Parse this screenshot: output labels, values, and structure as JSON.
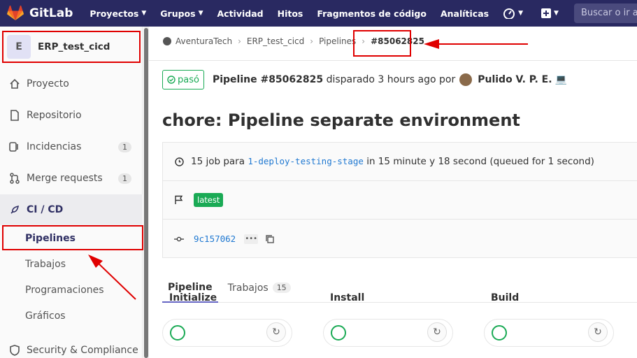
{
  "topbar": {
    "brand": "GitLab",
    "nav": [
      {
        "label": "Proyectos",
        "dropdown": true
      },
      {
        "label": "Grupos",
        "dropdown": true
      },
      {
        "label": "Actividad",
        "dropdown": false
      },
      {
        "label": "Hitos",
        "dropdown": false
      },
      {
        "label": "Fragmentos de código",
        "dropdown": false
      },
      {
        "label": "Analíticas",
        "dropdown": false
      }
    ],
    "search_placeholder": "Buscar o ir a"
  },
  "sidebar": {
    "project_initial": "E",
    "project_name": "ERP_test_cicd",
    "items": [
      {
        "label": "Proyecto",
        "icon": "home-icon"
      },
      {
        "label": "Repositorio",
        "icon": "doc-icon"
      },
      {
        "label": "Incidencias",
        "icon": "issues-icon",
        "badge": "1"
      },
      {
        "label": "Merge requests",
        "icon": "merge-icon",
        "badge": "1"
      },
      {
        "label": "CI / CD",
        "icon": "rocket-icon"
      }
    ],
    "cicd_subitems": [
      "Pipelines",
      "Trabajos",
      "Programaciones",
      "Gráficos"
    ],
    "bottom_item": {
      "label": "Security & Compliance",
      "icon": "shield-icon"
    }
  },
  "breadcrumb": {
    "items": [
      "AventuraTech",
      "ERP_test_cicd",
      "Pipelines"
    ],
    "current": "#85062825"
  },
  "pipeline": {
    "status": "pasó",
    "header_bold": "Pipeline #85062825",
    "header_rest": "disparado 3 hours ago por",
    "user": "Pulido V. P. E.",
    "title": "chore: Pipeline separate environment",
    "jobs_prefix": "15 job para",
    "branch": "1-deploy-testing-stage",
    "jobs_suffix": "in 15 minute y 18 second (queued for 1 second)",
    "tag": "latest",
    "commit": "9c157062"
  },
  "tabs": [
    {
      "label": "Pipeline",
      "count": ""
    },
    {
      "label": "Trabajos",
      "count": "15"
    }
  ],
  "stages": [
    "Initialize",
    "Install",
    "Build"
  ],
  "colors": {
    "navbar": "#292961",
    "success": "#1aaa55",
    "link": "#1f78d1",
    "annotation": "#e00000"
  }
}
